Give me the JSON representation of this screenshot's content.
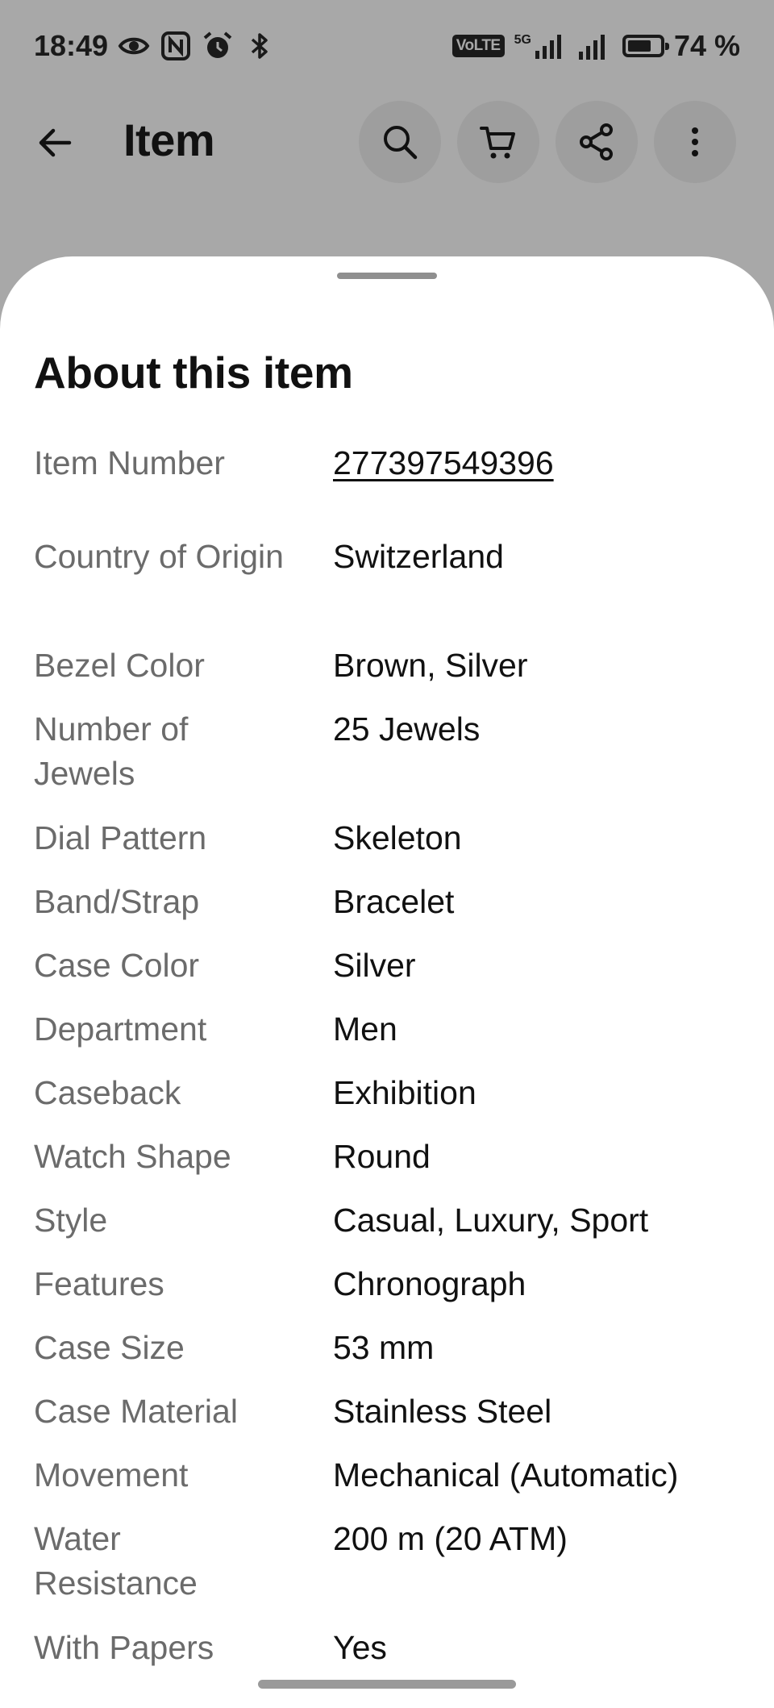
{
  "status_bar": {
    "time": "18:49",
    "volte": "VoLTE",
    "network": "5G",
    "battery_percent": "74 %",
    "battery_level": 0.74
  },
  "app_bar": {
    "title": "Item"
  },
  "sheet": {
    "title": "About this item",
    "specs": [
      {
        "label": "Item Number",
        "value": "277397549396"
      },
      {
        "label": "Country of Origin",
        "value": "Switzerland"
      },
      {
        "label": "Bezel Color",
        "value": "Brown, Silver"
      },
      {
        "label": "Number of Jewels",
        "value": "25 Jewels"
      },
      {
        "label": "Dial Pattern",
        "value": "Skeleton"
      },
      {
        "label": "Band/Strap",
        "value": "Bracelet"
      },
      {
        "label": "Case Color",
        "value": "Silver"
      },
      {
        "label": "Department",
        "value": "Men"
      },
      {
        "label": "Caseback",
        "value": "Exhibition"
      },
      {
        "label": "Watch Shape",
        "value": "Round"
      },
      {
        "label": "Style",
        "value": "Casual, Luxury, Sport"
      },
      {
        "label": "Features",
        "value": "Chronograph"
      },
      {
        "label": "Case Size",
        "value": "53 mm"
      },
      {
        "label": "Case Material",
        "value": "Stainless Steel"
      },
      {
        "label": "Movement",
        "value": "Mechanical (Automatic)"
      },
      {
        "label": "Water Resistance",
        "value": "200 m (20 ATM)"
      },
      {
        "label": "With Papers",
        "value": "Yes"
      }
    ]
  }
}
